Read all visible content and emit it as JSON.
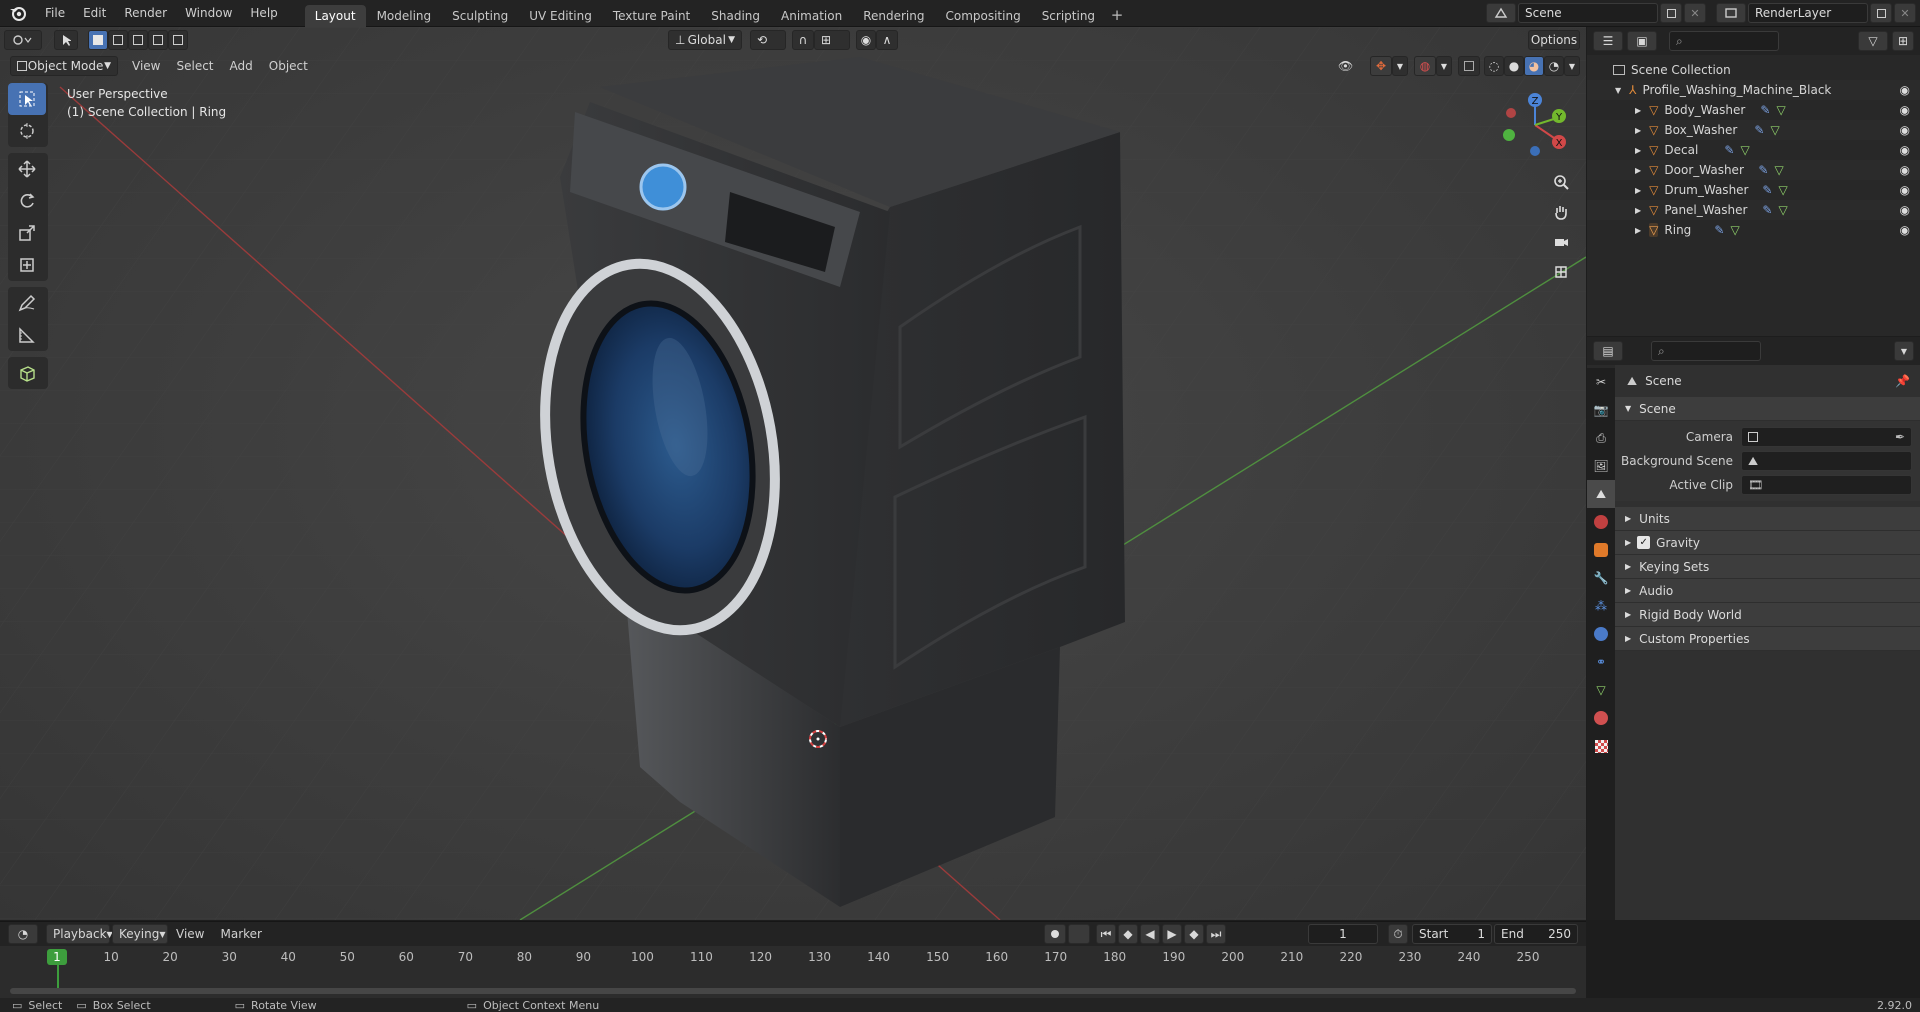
{
  "topbar": {
    "menus": [
      "File",
      "Edit",
      "Render",
      "Window",
      "Help"
    ],
    "workspaces": [
      "Layout",
      "Modeling",
      "Sculpting",
      "UV Editing",
      "Texture Paint",
      "Shading",
      "Animation",
      "Rendering",
      "Compositing",
      "Scripting"
    ],
    "active_workspace": "Layout",
    "add_label": "+",
    "scene_name": "Scene",
    "view_layer": "RenderLayer"
  },
  "viewport": {
    "mode": "Object Mode",
    "menus": [
      "View",
      "Select",
      "Add",
      "Object"
    ],
    "orientation": "Global",
    "options_label": "Options",
    "info_line1": "User Perspective",
    "info_line2": "(1) Scene Collection | Ring",
    "gizmo": {
      "x": "X",
      "y": "Y",
      "z": "Z"
    }
  },
  "outliner": {
    "root": "Scene Collection",
    "collection": "Profile_Washing_Machine_Black",
    "objects": [
      "Body_Washer",
      "Box_Washer",
      "Decal",
      "Door_Washer",
      "Drum_Washer",
      "Panel_Washer",
      "Ring"
    ]
  },
  "properties": {
    "header": "Scene",
    "section": "Scene",
    "fields": [
      {
        "label": "Camera"
      },
      {
        "label": "Background Scene"
      },
      {
        "label": "Active Clip"
      }
    ],
    "panels": [
      "Units",
      "Gravity",
      "Keying Sets",
      "Audio",
      "Rigid Body World",
      "Custom Properties"
    ],
    "gravity_checked": true
  },
  "timeline": {
    "menus": [
      "Playback",
      "Keying",
      "View",
      "Marker"
    ],
    "current_frame": "1",
    "start_label": "Start",
    "start": "1",
    "end_label": "End",
    "end": "250",
    "ruler": [
      "10",
      "20",
      "30",
      "40",
      "50",
      "60",
      "70",
      "80",
      "90",
      "100",
      "110",
      "120",
      "130",
      "140",
      "150",
      "160",
      "170",
      "180",
      "190",
      "200",
      "210",
      "220",
      "230",
      "240",
      "250"
    ],
    "playhead_label": "1"
  },
  "statusbar": {
    "select": "Select",
    "box_select": "Box Select",
    "rotate": "Rotate View",
    "context": "Object Context Menu",
    "version": "2.92.0"
  },
  "colors": {
    "accent": "#4772b3",
    "header": "#232323",
    "panel": "#3d3d3d",
    "object_icon": "#e38b3a",
    "playhead": "#3d9e3d"
  }
}
